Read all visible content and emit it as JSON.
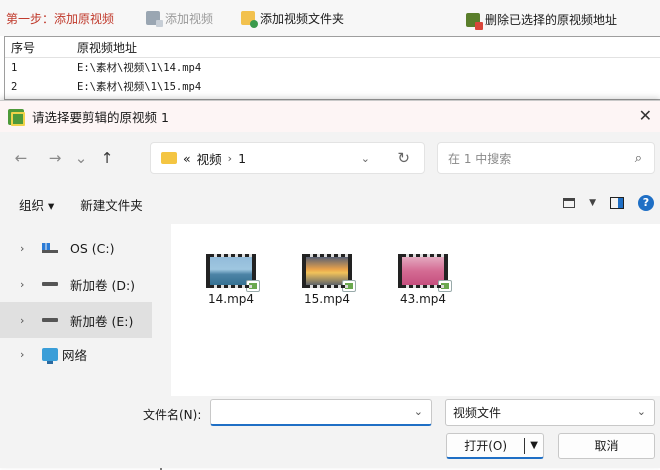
{
  "app": {
    "step_label": "第一步：添加原视频",
    "toolbar": [
      {
        "label": "添加视频",
        "icon": "film-add-icon",
        "disabled": true
      },
      {
        "label": "添加视频文件夹",
        "icon": "folder-add-icon",
        "disabled": false
      },
      {
        "label": "删除已选择的原视频地址",
        "icon": "delete-icon",
        "disabled": false
      }
    ],
    "list": {
      "headers": [
        "序号",
        "原视频地址"
      ],
      "rows": [
        {
          "idx": "1",
          "path": "E:\\素材\\视频\\1\\14.mp4"
        },
        {
          "idx": "2",
          "path": "E:\\素材\\视频\\1\\15.mp4"
        }
      ]
    }
  },
  "dialog": {
    "title": "请选择要剪辑的原视频 1",
    "close_glyph": "✕",
    "nav": {
      "back": "←",
      "forward": "→",
      "recent": "⌄",
      "up": "↑"
    },
    "address": {
      "overflow": "«",
      "crumbs": [
        "视频",
        "1"
      ],
      "separator": "›"
    },
    "search_placeholder": "在 1 中搜索",
    "commands": {
      "organize": "组织 ▾",
      "new_folder": "新建文件夹"
    },
    "tree": [
      {
        "label": "OS (C:)",
        "icon": "windows-drive-icon",
        "selected": false
      },
      {
        "label": "新加卷 (D:)",
        "icon": "drive-icon",
        "selected": false
      },
      {
        "label": "新加卷 (E:)",
        "icon": "drive-icon",
        "selected": true
      },
      {
        "label": "网络",
        "icon": "network-icon",
        "selected": false
      }
    ],
    "files": [
      {
        "name": "14.mp4",
        "thumb": "sea"
      },
      {
        "name": "15.mp4",
        "thumb": "sunset"
      },
      {
        "name": "43.mp4",
        "thumb": "tulips"
      }
    ],
    "filename_label": "文件名(N):",
    "filename_value": "",
    "file_type": "视频文件",
    "open_button": "打开(O)",
    "cancel_button": "取消"
  }
}
